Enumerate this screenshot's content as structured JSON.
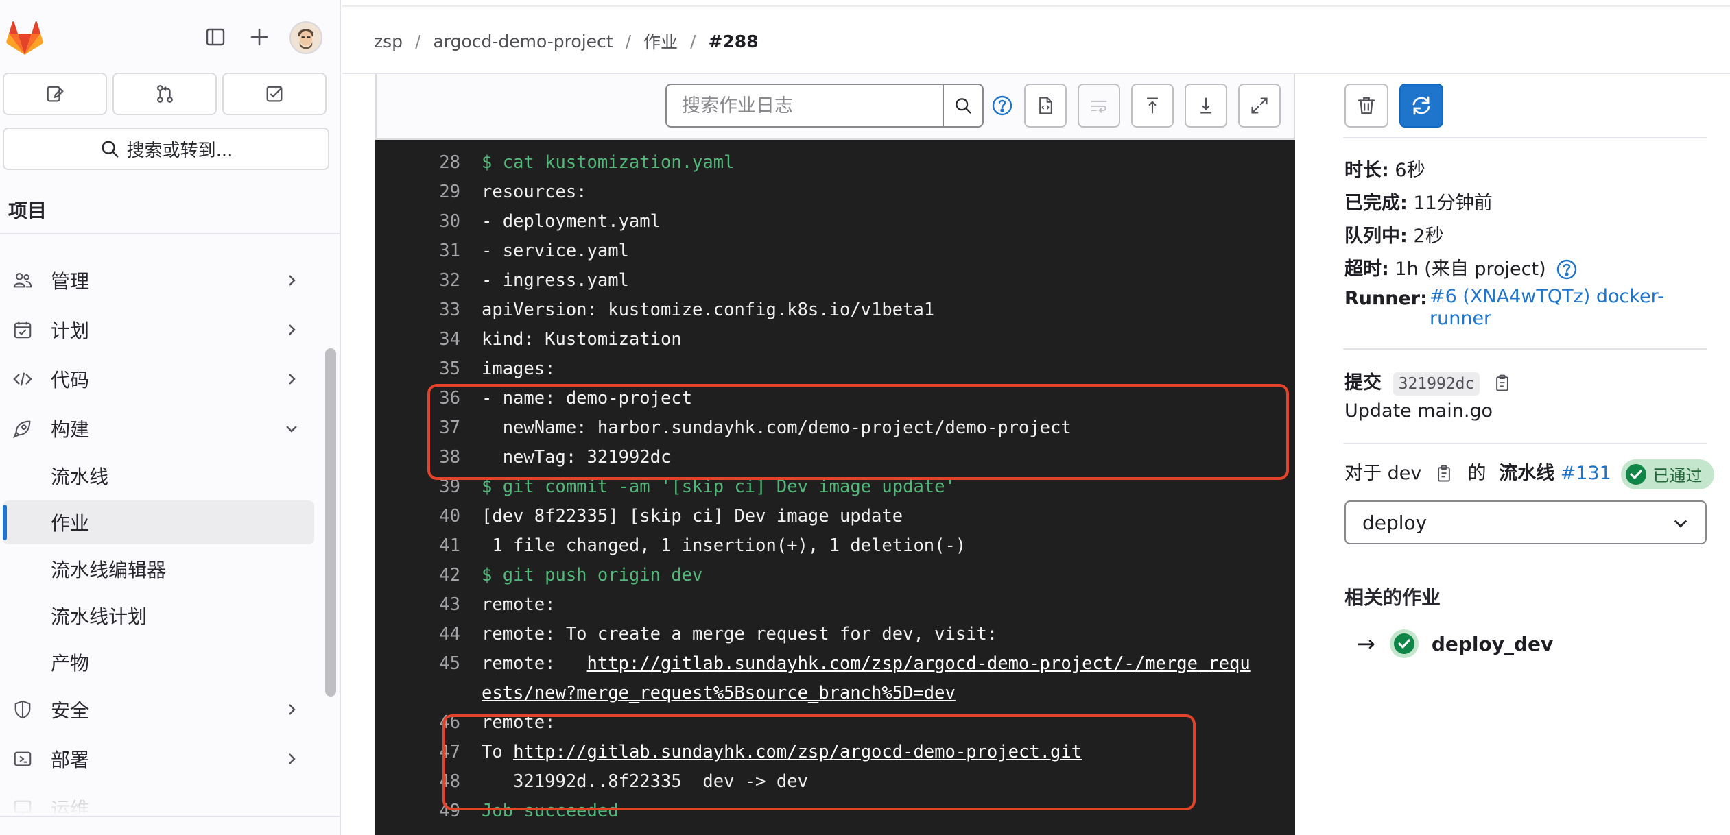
{
  "nav": {
    "search_label": "搜索或转到...",
    "section_title": "项目",
    "groups": [
      {
        "label": "管理"
      },
      {
        "label": "计划"
      },
      {
        "label": "代码"
      },
      {
        "label": "构建"
      },
      {
        "label": "安全"
      },
      {
        "label": "部署"
      },
      {
        "label": "运维"
      }
    ],
    "build_subitems": [
      {
        "label": "流水线"
      },
      {
        "label": "作业"
      },
      {
        "label": "流水线编辑器"
      },
      {
        "label": "流水线计划"
      },
      {
        "label": "产物"
      }
    ],
    "active_subitem": "作业"
  },
  "breadcrumb": {
    "items": [
      "zsp",
      "argocd-demo-project",
      "作业"
    ],
    "current": "#288"
  },
  "log": {
    "search_placeholder": "搜索作业日志",
    "lines": [
      {
        "n": "28",
        "text": "$ cat kustomization.yaml",
        "cmd": true
      },
      {
        "n": "29",
        "text": "resources:"
      },
      {
        "n": "30",
        "text": "- deployment.yaml"
      },
      {
        "n": "31",
        "text": "- service.yaml"
      },
      {
        "n": "32",
        "text": "- ingress.yaml"
      },
      {
        "n": "33",
        "text": "apiVersion: kustomize.config.k8s.io/v1beta1"
      },
      {
        "n": "34",
        "text": "kind: Kustomization"
      },
      {
        "n": "35",
        "text": "images:"
      },
      {
        "n": "36",
        "text": "- name: demo-project"
      },
      {
        "n": "37",
        "text": "  newName: harbor.sundayhk.com/demo-project/demo-project"
      },
      {
        "n": "38",
        "text": "  newTag: 321992dc"
      },
      {
        "n": "39",
        "text": "$ git commit -am '[skip ci] Dev image update'",
        "cmd": true
      },
      {
        "n": "40",
        "text": "[dev 8f22335] [skip ci] Dev image update"
      },
      {
        "n": "41",
        "text": " 1 file changed, 1 insertion(+), 1 deletion(-)"
      },
      {
        "n": "42",
        "text": "$ git push origin dev",
        "cmd": true
      },
      {
        "n": "43",
        "text": "remote:"
      },
      {
        "n": "44",
        "text": "remote: To create a merge request for dev, visit:"
      },
      {
        "n": "45",
        "prefix": "remote:   ",
        "link": "http://gitlab.sundayhk.com/zsp/argocd-demo-project/-/merge_requ"
      },
      {
        "n": "",
        "link": "ests/new?merge_request%5Bsource_branch%5D=dev"
      },
      {
        "n": "46",
        "text": "remote:"
      },
      {
        "n": "47",
        "prefix": "To ",
        "link": "http://gitlab.sundayhk.com/zsp/argocd-demo-project.git"
      },
      {
        "n": "48",
        "text": "   321992d..8f22335  dev -> dev"
      },
      {
        "n": "49",
        "text": "Job succeeded",
        "cmd": true
      }
    ]
  },
  "job": {
    "duration_label": "时长:",
    "duration_value": "6秒",
    "finished_label": "已完成:",
    "finished_value": "11分钟前",
    "queued_label": "队列中:",
    "queued_value": "2秒",
    "timeout_label": "超时:",
    "timeout_value": "1h (来自 project)",
    "runner_label": "Runner:",
    "runner_value": "#6 (XNA4wTQTz) docker-runner",
    "commit_label": "提交",
    "commit_sha": "321992dc",
    "commit_message": "Update main.go",
    "pipeline_prefix": "对于 dev",
    "pipeline_middle": "的",
    "pipeline_label": "流水线",
    "pipeline_link": "#131",
    "pipeline_status": "已通过",
    "stage_selected": "deploy",
    "related_title": "相关的作业",
    "related_jobs": [
      {
        "name": "deploy_dev"
      }
    ]
  },
  "colors": {
    "accent": "#1f75cb",
    "success": "#108548",
    "highlight_box": "#e24329",
    "log_bg": "#1f1f1f"
  }
}
